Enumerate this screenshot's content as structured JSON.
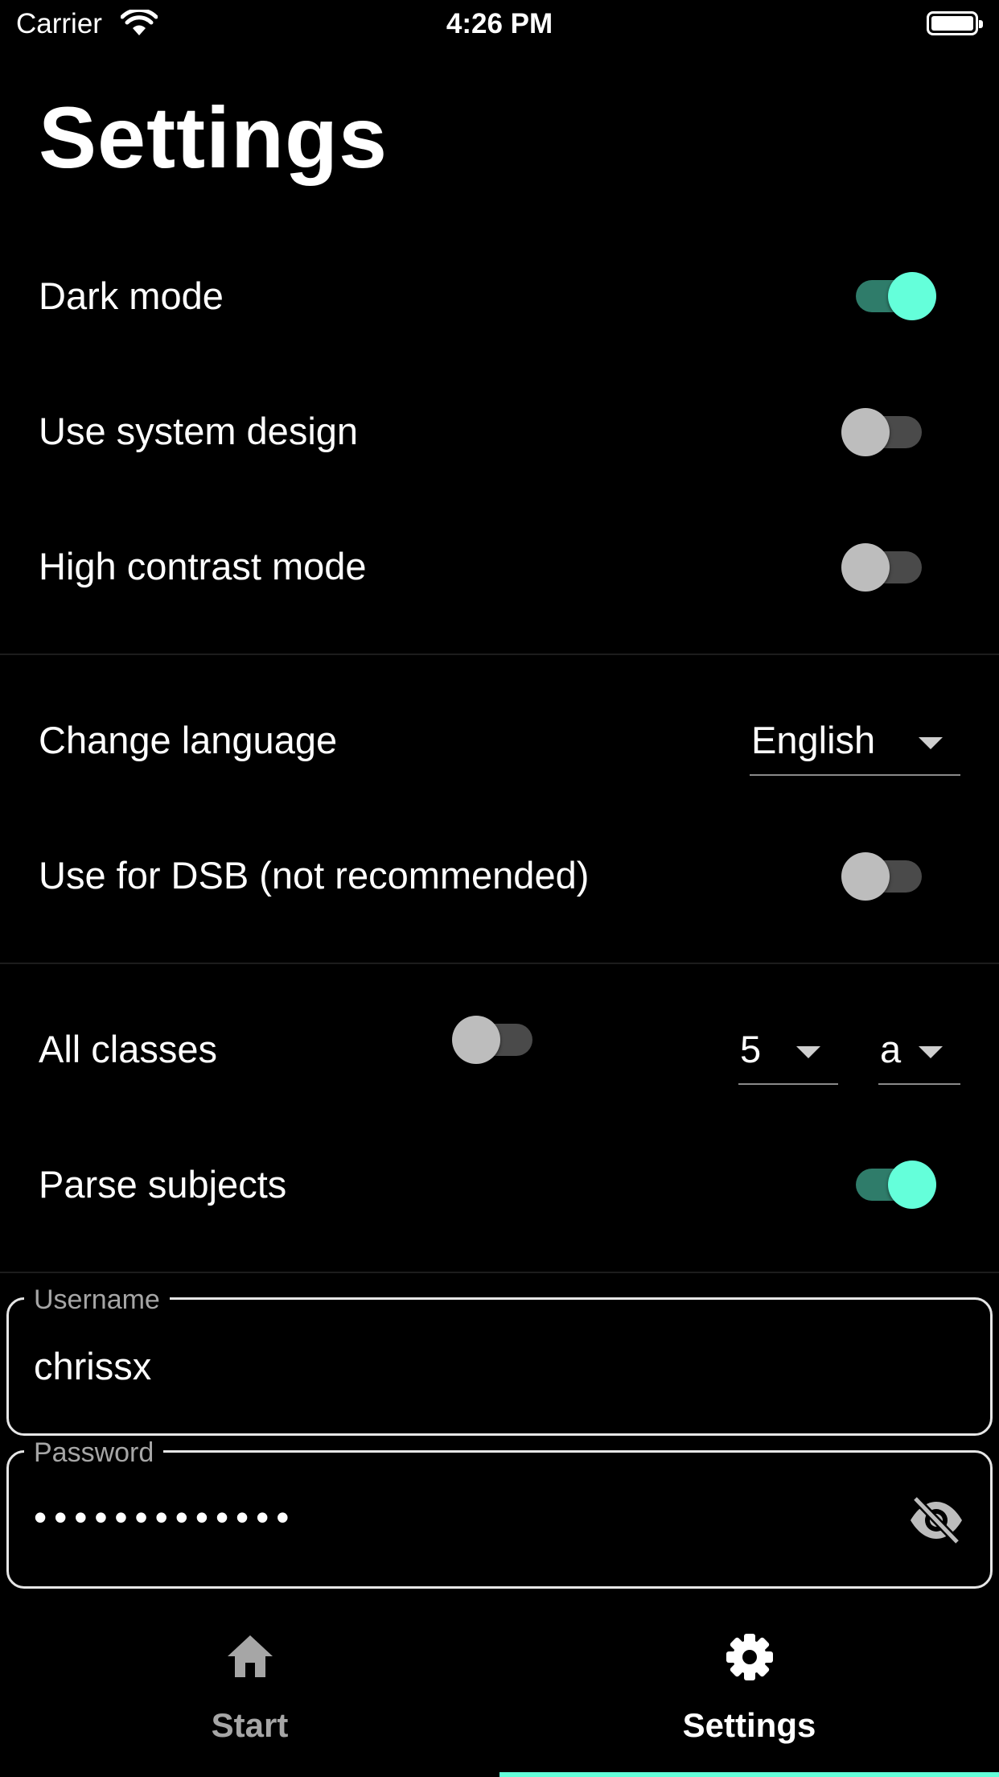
{
  "status_bar": {
    "carrier": "Carrier",
    "time": "4:26 PM"
  },
  "page_title": "Settings",
  "settings": {
    "dark_mode": {
      "label": "Dark mode",
      "on": true
    },
    "system_design": {
      "label": "Use system design",
      "on": false
    },
    "high_contrast": {
      "label": "High contrast mode",
      "on": false
    },
    "language": {
      "label": "Change language",
      "value": "English"
    },
    "dsb": {
      "label": "Use for DSB (not recommended)",
      "on": false
    },
    "all_classes": {
      "label": "All classes",
      "on": false,
      "grade": "5",
      "class_letter": "a"
    },
    "parse_subjects": {
      "label": "Parse subjects",
      "on": true
    }
  },
  "username": {
    "label": "Username",
    "value": "chrissx"
  },
  "password": {
    "label": "Password",
    "value": "•••••••••••••"
  },
  "nav": {
    "items": [
      {
        "label": "Start",
        "icon": "home-icon",
        "active": false
      },
      {
        "label": "Settings",
        "icon": "gear-icon",
        "active": true
      }
    ]
  },
  "colors": {
    "accent": "#64ffda",
    "switch_track_on": "#2f7c6a",
    "inactive": "#a6a6a6"
  }
}
